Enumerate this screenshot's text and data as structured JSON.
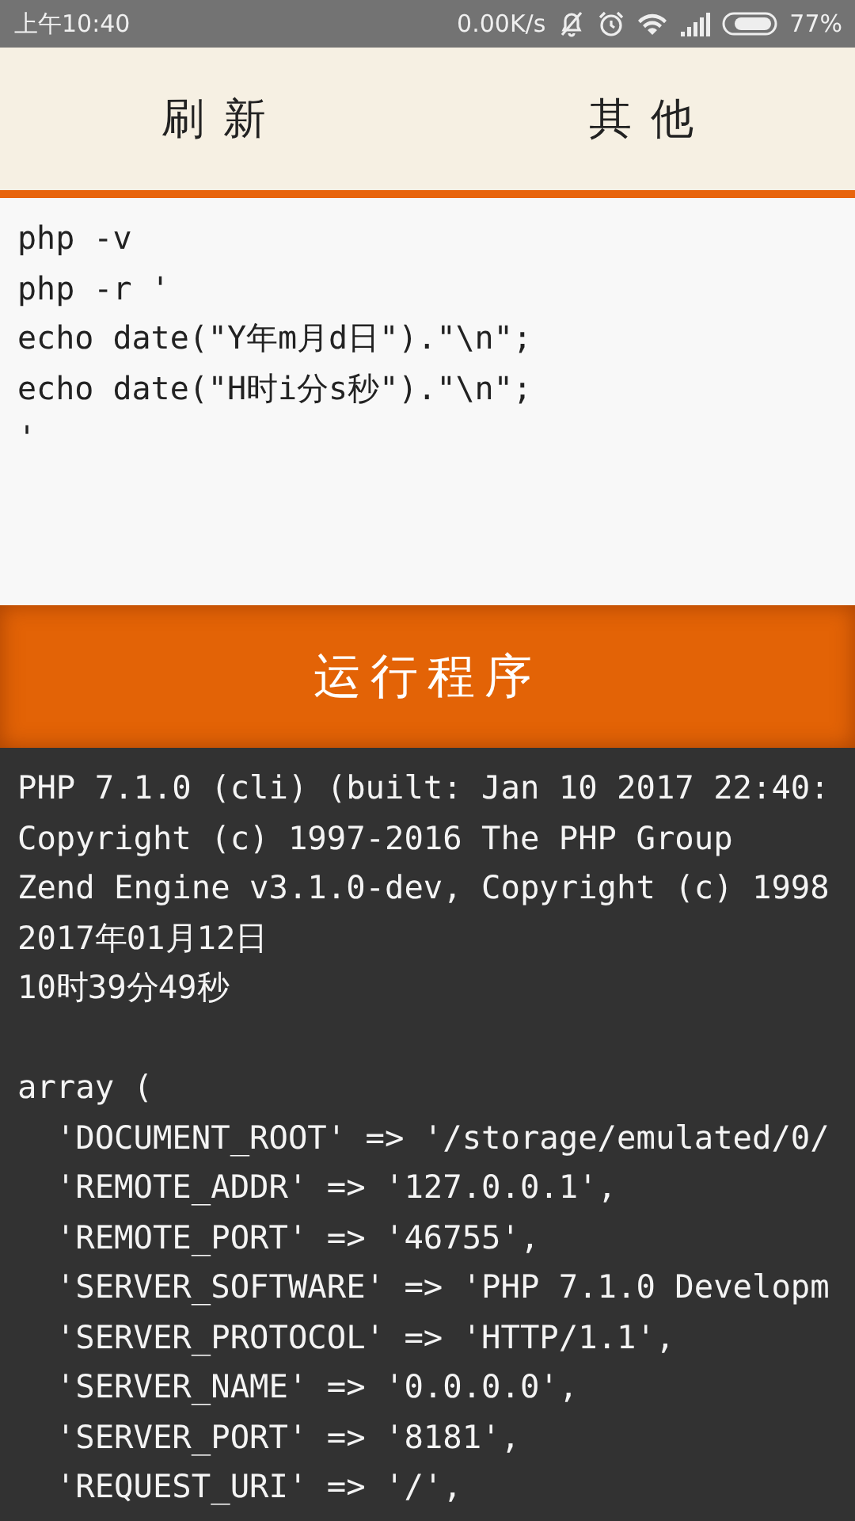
{
  "status_bar": {
    "time": "上午10:40",
    "speed": "0.00K/s",
    "battery": "77%"
  },
  "tabs": [
    {
      "label": "刷新"
    },
    {
      "label": "其他"
    }
  ],
  "editor": {
    "lines": [
      "php -v",
      "php -r '",
      "echo date(\"Y年m月d日\").\"\\n\";",
      "echo date(\"H时i分s秒\").\"\\n\";",
      "'"
    ]
  },
  "run_button": {
    "label": "运行程序"
  },
  "output": {
    "blocks": [
      [
        "PHP 7.1.0 (cli) (built: Jan 10 2017 22:40:",
        "Copyright (c) 1997-2016 The PHP Group",
        "Zend Engine v3.1.0-dev, Copyright (c) 1998",
        "2017年01月12日",
        "10时39分49秒"
      ],
      [
        "array (",
        "  'DOCUMENT_ROOT' => '/storage/emulated/0/",
        "  'REMOTE_ADDR' => '127.0.0.1',",
        "  'REMOTE_PORT' => '46755',",
        "  'SERVER_SOFTWARE' => 'PHP 7.1.0 Developm",
        "  'SERVER_PROTOCOL' => 'HTTP/1.1',",
        "  'SERVER_NAME' => '0.0.0.0',",
        "  'SERVER_PORT' => '8181',",
        "  'REQUEST_URI' => '/',"
      ]
    ]
  }
}
